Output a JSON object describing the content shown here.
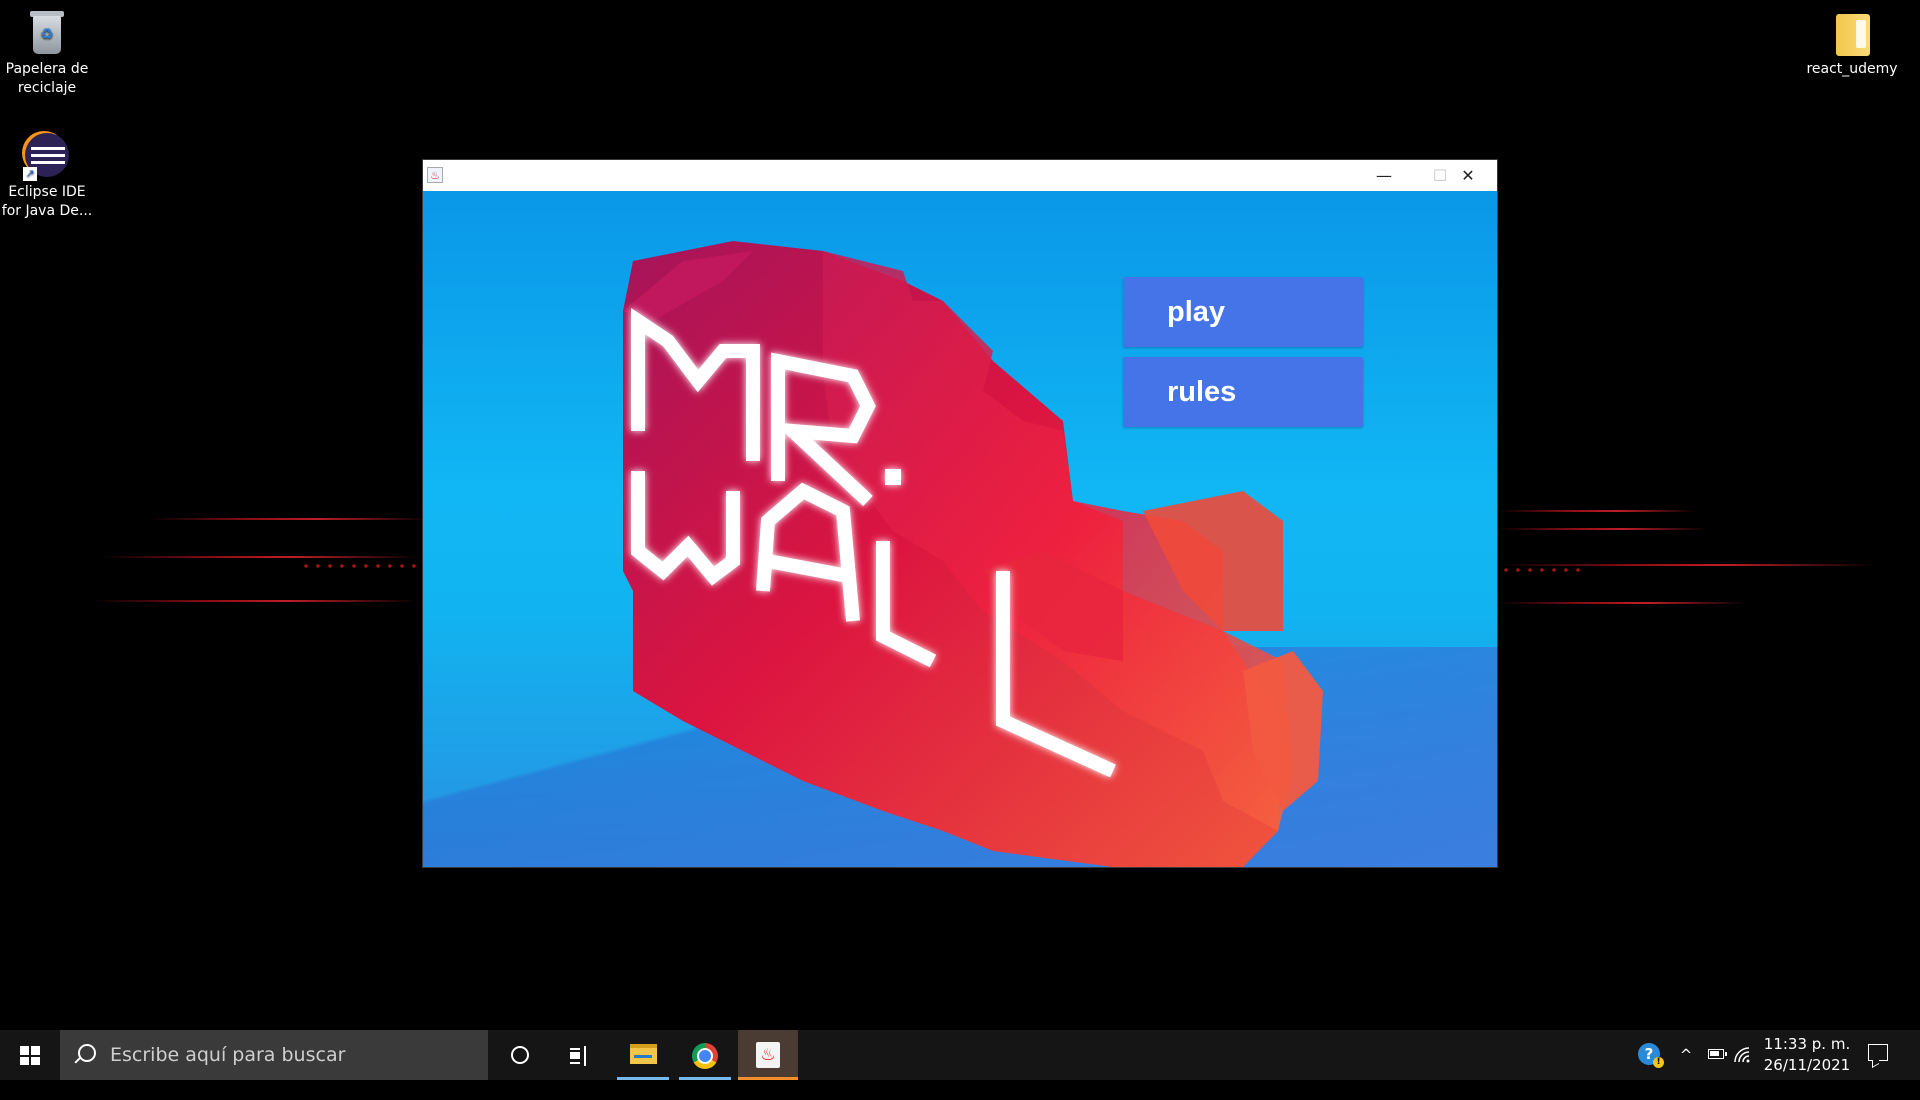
{
  "desktop": {
    "icons": [
      {
        "label_line1": "Papelera de",
        "label_line2": "reciclaje"
      },
      {
        "label_line1": "Eclipse IDE",
        "label_line2": "for Java De..."
      },
      {
        "label_line1": "react_udemy",
        "label_line2": ""
      }
    ]
  },
  "window": {
    "title": "",
    "controls": {
      "minimize": "—",
      "maximize": "☐",
      "close": "✕"
    },
    "game": {
      "logo_line1": "MR.",
      "logo_line2": "WALL",
      "buttons": [
        {
          "label": "play"
        },
        {
          "label": "rules"
        }
      ]
    }
  },
  "taskbar": {
    "search_placeholder": "Escribe aquí para buscar",
    "apps": [
      "file-explorer",
      "chrome",
      "java"
    ],
    "tray": {
      "chevron": "^"
    },
    "clock": {
      "time": "11:33 p. m.",
      "date": "26/11/2021"
    }
  },
  "colors": {
    "button_bg": "#4474e8",
    "sky_top": "#0a97e8",
    "sky_bottom": "#2a8fe0",
    "logo_magenta": "#b3155f",
    "logo_red": "#e8173f",
    "logo_orange": "#f26240",
    "taskbar_bg": "#151515"
  }
}
